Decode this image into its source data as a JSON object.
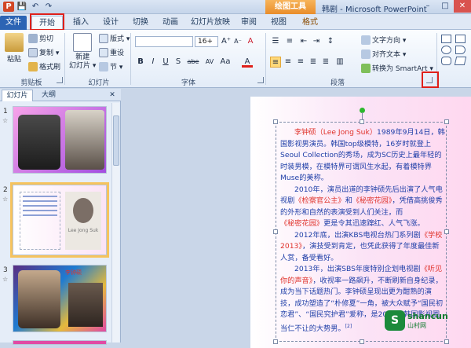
{
  "window": {
    "title": "韩剧 - Microsoft PowerPoint",
    "context_tab": "绘图工具",
    "win_buttons": [
      "–",
      "□",
      "✕"
    ]
  },
  "qat": [
    "P",
    "💾",
    "↶",
    "↷"
  ],
  "tabs": [
    "文件",
    "开始",
    "插入",
    "设计",
    "切换",
    "动画",
    "幻灯片放映",
    "审阅",
    "视图",
    "格式"
  ],
  "ribbon": {
    "clipboard": {
      "paste": "粘贴",
      "cut": "剪切",
      "copy": "复制 ▾",
      "format_painter": "格式刷",
      "label": "剪贴板"
    },
    "slides": {
      "new_slide": "新建\n幻灯片 ▾",
      "layout": "版式 ▾",
      "reset": "重设",
      "section": "节 ▾",
      "label": "幻灯片"
    },
    "font": {
      "name": "",
      "size": "16+",
      "grow": "A⁺",
      "shrink": "A⁻",
      "clear": "A",
      "bold": "B",
      "italic": "I",
      "underline": "U",
      "shadow": "S",
      "strike": "abe",
      "spacing": "AV",
      "case": "Aa",
      "color": "A",
      "label": "字体"
    },
    "paragraph": {
      "text_direction": "文字方向 ▾",
      "align_text": "对齐文本 ▾",
      "smartart": "转换为 SmartArt ▾",
      "label": "段落"
    }
  },
  "left_pane": {
    "tabs": [
      "幻灯片",
      "大纲"
    ],
    "close": "✕",
    "slides": [
      {
        "num": "1",
        "star": "☆",
        "caption": ""
      },
      {
        "num": "2",
        "star": "☆",
        "caption": "Lee Jong Suk"
      },
      {
        "num": "3",
        "star": "☆",
        "caption": "李钟硕"
      }
    ]
  },
  "slide_text": {
    "p1_name": "李钟硕（Lee Jong Suk）",
    "p1": "1989年9月14日，韩国影视男演员。韩国top级模特，16岁时就登上Seoul Collection的秀场，成为SC历史上最年轻的时装男模，在模特界可谓风生水起，有着模特界Muse的美称。",
    "p2a": "2010年，演员出道的李钟硕先后出演了人气电视剧",
    "p2b": "《检察官公主》",
    "p2c": "和",
    "p2d": "《秘密花园》",
    "p2e": "，凭借高挑俊秀的外形和自然的表演受到人们关注，而",
    "p2f": "《秘密花园》",
    "p2g": "更是令其迅速蹿红、人气飞涨。",
    "p3a": "2012年底，出演KBS电视台热门系列剧",
    "p3b": "《学校2013》",
    "p3c": "，演技受到肯定，也凭此获得了年度最佳新人赏，备受看好。",
    "p4a": "2013年，出演SBS年度特别企划电视剧",
    "p4b": "《听见你的声音》",
    "p4c": "，收视率一路飙升，不断刷新自身纪录，成为当下话题热门。李钟硕呈现出更为酣熟的演技，成功塑造了“朴修夏”一角，被大众赋予“国民初恋君”、“国民究护君”爱称，是2013年韩国影视圈当仁不让的大势男。",
    "ref": "[2]"
  },
  "watermark": {
    "logo": "S",
    "line1": "shancun",
    "line2": "山村网"
  },
  "colors": {
    "accent": "#2c64b4",
    "highlight": "#e0201a",
    "text_blue": "#1f3fa8",
    "text_red": "#e0322b"
  }
}
